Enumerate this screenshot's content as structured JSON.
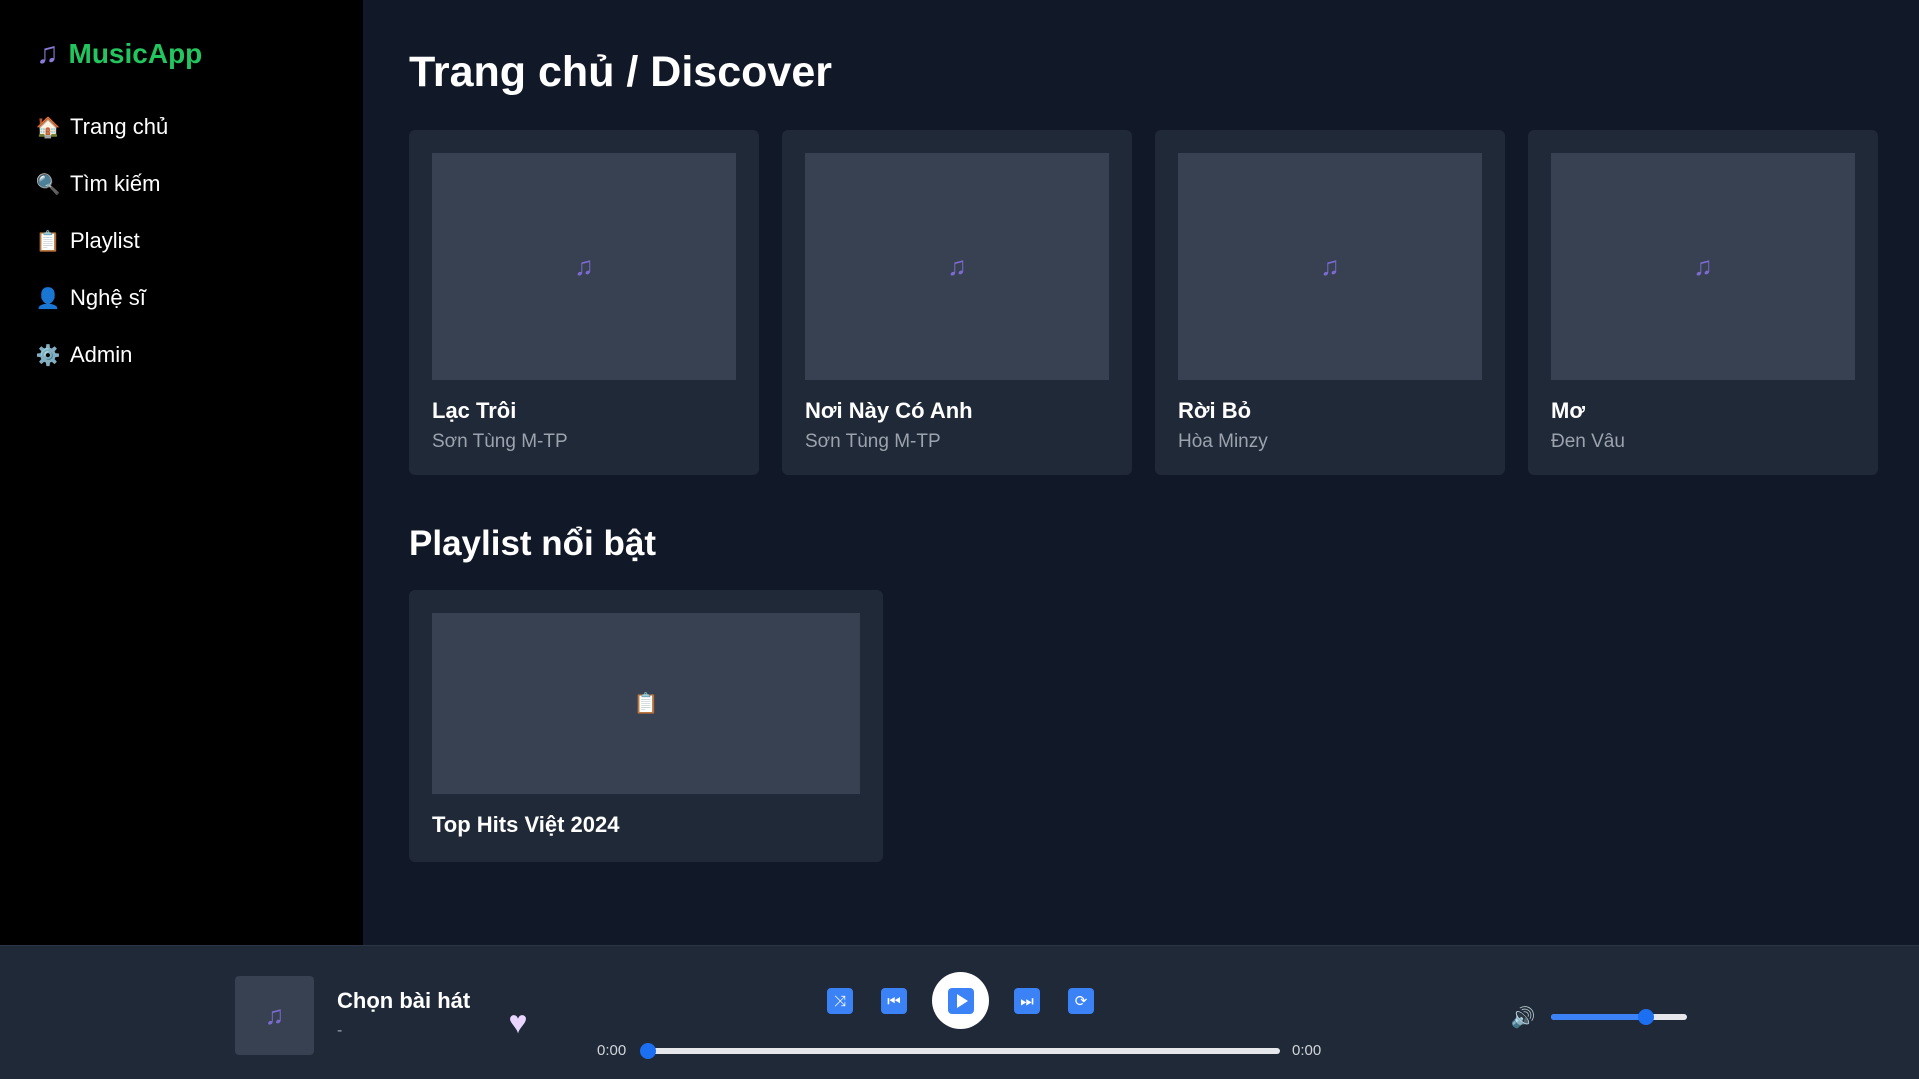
{
  "app": {
    "logo_icon": "music-note-icon",
    "name": "MusicApp",
    "brand_color": "#22c55e"
  },
  "sidebar": {
    "items": [
      {
        "icon": "house-icon",
        "glyph": "🏠",
        "label": "Trang chủ"
      },
      {
        "icon": "search-icon",
        "glyph": "🔍",
        "label": "Tìm kiếm"
      },
      {
        "icon": "clipboard-icon",
        "glyph": "📋",
        "label": "Playlist"
      },
      {
        "icon": "person-icon",
        "glyph": "👤",
        "label": "Nghệ sĩ"
      },
      {
        "icon": "gear-icon",
        "glyph": "⚙️",
        "label": "Admin"
      }
    ]
  },
  "main": {
    "title": "Trang chủ / Discover",
    "songs": [
      {
        "title": "Lạc Trôi",
        "artist": "Sơn Tùng M-TP",
        "cover_icon": "music-note-icon"
      },
      {
        "title": "Nơi Này Có Anh",
        "artist": "Sơn Tùng M-TP",
        "cover_icon": "music-note-icon"
      },
      {
        "title": "Rời Bỏ",
        "artist": "Hòa Minzy",
        "cover_icon": "music-note-icon"
      },
      {
        "title": "Mơ",
        "artist": "Đen Vâu",
        "cover_icon": "music-note-icon"
      }
    ],
    "featured_section_title": "Playlist nổi bật",
    "playlists": [
      {
        "title": "Top Hits Việt 2024",
        "cover_icon": "clipboard-icon"
      }
    ]
  },
  "player": {
    "now_playing_title": "Chọn bài hát",
    "now_playing_artist": "-",
    "thumb_icon": "music-note-icon",
    "like_icon": "heart-icon",
    "controls": [
      "shuffle-icon",
      "previous-icon",
      "play-icon",
      "next-icon",
      "repeat-icon"
    ],
    "current_time": "0:00",
    "total_time": "0:00",
    "progress": 0,
    "volume_icon": "speaker-icon",
    "volume": 0.7,
    "accent_color": "#3b82f6"
  }
}
